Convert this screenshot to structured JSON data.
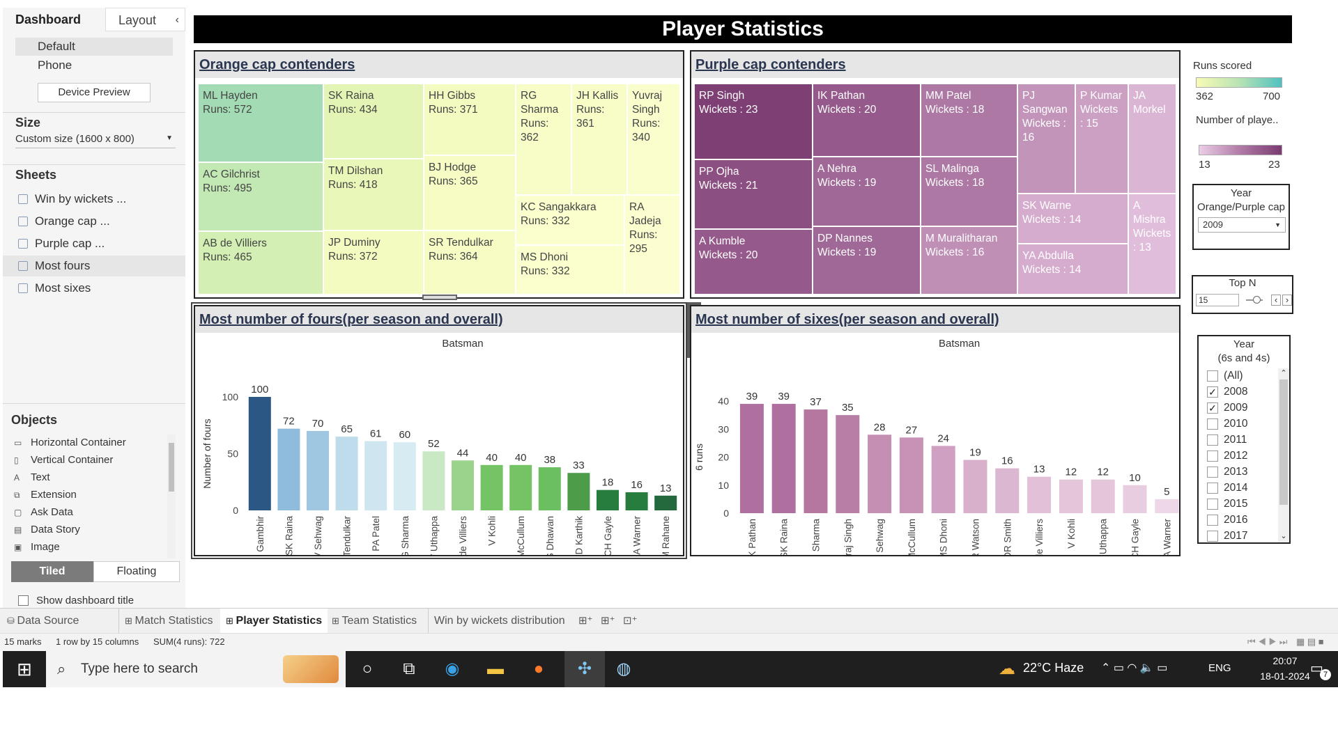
{
  "left_panel": {
    "tabs": {
      "dashboard": "Dashboard",
      "layout": "Layout"
    },
    "device": {
      "default": "Default",
      "phone": "Phone",
      "preview_button": "Device Preview"
    },
    "size": {
      "heading": "Size",
      "value": "Custom size (1600 x 800)"
    },
    "sheets": {
      "heading": "Sheets",
      "items": [
        "Win by wickets ...",
        "Orange cap ...",
        "Purple cap ...",
        "Most fours",
        "Most sixes"
      ]
    },
    "objects": {
      "heading": "Objects",
      "items": [
        "Horizontal Container",
        "Vertical Container",
        "Text",
        "Extension",
        "Ask Data",
        "Data Story",
        "Image"
      ]
    },
    "layout_mode": {
      "tiled": "Tiled",
      "floating": "Floating"
    },
    "show_title": "Show dashboard title"
  },
  "dashboard": {
    "title": "Player Statistics",
    "orange": {
      "heading": "Orange cap contenders",
      "cells": [
        {
          "name": "ML Hayden",
          "value": "Runs: 572",
          "color": "#a3dcb4"
        },
        {
          "name": "AC Gilchrist",
          "value": "Runs: 495",
          "color": "#c2e8b4"
        },
        {
          "name": "AB de Villiers",
          "value": "Runs: 465",
          "color": "#d3efb4"
        },
        {
          "name": "SK Raina",
          "value": "Runs: 434",
          "color": "#e2f5b4"
        },
        {
          "name": "TM Dilshan",
          "value": "Runs: 418",
          "color": "#e9f7b8"
        },
        {
          "name": "JP Duminy",
          "value": "Runs: 372",
          "color": "#f4fbc0"
        },
        {
          "name": "HH Gibbs",
          "value": "Runs: 371",
          "color": "#f4fbc0"
        },
        {
          "name": "BJ Hodge",
          "value": "Runs: 365",
          "color": "#f6fcc4"
        },
        {
          "name": "SR Tendulkar",
          "value": "Runs: 364",
          "color": "#f6fcc4"
        },
        {
          "name": "RG Sharma",
          "value": "Runs: 362",
          "color": "#f8fdc8"
        },
        {
          "name": "JH Kallis",
          "value": "Runs: 361",
          "color": "#f8fdc8"
        },
        {
          "name": "Yuvraj Singh",
          "value": "Runs: 340",
          "color": "#fafdcc"
        },
        {
          "name": "KC Sangakkara",
          "value": "Runs: 332",
          "color": "#fbfecd"
        },
        {
          "name": "MS Dhoni",
          "value": "Runs: 332",
          "color": "#fbfecd"
        },
        {
          "name": "RA Jadeja",
          "value": "Runs: 295",
          "color": "#fcfed0"
        }
      ]
    },
    "purple": {
      "heading": "Purple cap contenders",
      "cells": [
        {
          "name": "RP Singh",
          "value": "Wickets : 23",
          "color": "#7d3f74"
        },
        {
          "name": "PP Ojha",
          "value": "Wickets : 21",
          "color": "#8c4f82"
        },
        {
          "name": "A Kumble",
          "value": "Wickets : 20",
          "color": "#955a8b"
        },
        {
          "name": "IK Pathan",
          "value": "Wickets : 20",
          "color": "#955a8b"
        },
        {
          "name": "A Nehra",
          "value": "Wickets : 19",
          "color": "#a06896"
        },
        {
          "name": "DP Nannes",
          "value": "Wickets : 19",
          "color": "#a06896"
        },
        {
          "name": "MM Patel",
          "value": "Wickets : 18",
          "color": "#ad78a3"
        },
        {
          "name": "SL Malinga",
          "value": "Wickets : 18",
          "color": "#ad78a3"
        },
        {
          "name": "M Muralitharan",
          "value": "Wickets : 16",
          "color": "#bf8fb6"
        },
        {
          "name": "PJ Sangwan",
          "value": "Wickets : 16",
          "color": "#c294b9"
        },
        {
          "name": "P Kumar",
          "value": "Wickets : 15",
          "color": "#cba0c3"
        },
        {
          "name": "JA Morkel",
          "value": "",
          "color": "#dbb5d4"
        },
        {
          "name": "SK Warne",
          "value": "Wickets : 14",
          "color": "#d6acce"
        },
        {
          "name": "YA Abdulla",
          "value": "Wickets : 14",
          "color": "#d6acce"
        },
        {
          "name": "A Mishra",
          "value": "Wickets : 13",
          "color": "#e0bedb"
        }
      ]
    },
    "fours": {
      "heading": "Most number of fours(per season and overall)"
    },
    "sixes": {
      "heading": "Most number of sixes(per season and overall)"
    },
    "legend": {
      "runs_title": "Runs scored",
      "runs_min": "362",
      "runs_max": "700",
      "players_title": "Number of playe..",
      "players_min": "13",
      "players_max": "23"
    },
    "year_filter": {
      "title_line1": "Year",
      "title_line2": "Orange/Purple cap",
      "value": "2009"
    },
    "top_n": {
      "title": "Top N",
      "value": "15"
    },
    "year_list": {
      "title_line1": "Year",
      "title_line2": "(6s and 4s)",
      "items": [
        {
          "label": "(All)",
          "checked": false
        },
        {
          "label": "2008",
          "checked": true
        },
        {
          "label": "2009",
          "checked": true
        },
        {
          "label": "2010",
          "checked": false
        },
        {
          "label": "2011",
          "checked": false
        },
        {
          "label": "2012",
          "checked": false
        },
        {
          "label": "2013",
          "checked": false
        },
        {
          "label": "2014",
          "checked": false
        },
        {
          "label": "2015",
          "checked": false
        },
        {
          "label": "2016",
          "checked": false
        },
        {
          "label": "2017",
          "checked": false
        }
      ]
    }
  },
  "chart_data": [
    {
      "type": "bar",
      "title": "",
      "xlabel": "Batsman",
      "ylabel": "Number of fours",
      "ylim": [
        0,
        100
      ],
      "yticks": [
        0,
        50,
        100
      ],
      "categories": [
        "G Gambhir",
        "SK Raina",
        "V Sehwag",
        "SR Tendulkar",
        "PA Patel",
        "RG Sharma",
        "RV Uthappa",
        "AB de Villiers",
        "V Kohli",
        "BB McCullum",
        "S Dhawan",
        "KD Karthik",
        "CH Gayle",
        "DA Warner",
        "AM Rahane"
      ],
      "values": [
        100,
        72,
        70,
        65,
        61,
        60,
        52,
        44,
        40,
        40,
        38,
        33,
        18,
        16,
        13
      ],
      "colors": [
        "#2a5783",
        "#8fbcdc",
        "#9fc7e1",
        "#bfdcec",
        "#cfe6f0",
        "#d6ebf2",
        "#c9e9c5",
        "#99d38c",
        "#74c466",
        "#74c466",
        "#6bbf60",
        "#4c9c4a",
        "#277d3e",
        "#277d3e",
        "#24693d"
      ]
    },
    {
      "type": "bar",
      "title": "",
      "xlabel": "Batsman",
      "ylabel": "6 runs",
      "ylim": [
        0,
        40
      ],
      "yticks": [
        0,
        10,
        20,
        30,
        40
      ],
      "categories": [
        "YK Pathan",
        "SK Raina",
        "RG Sharma",
        "Yuvraj Singh",
        "V Sehwag",
        "BB McCullum",
        "MS Dhoni",
        "SR Watson",
        "DR Smith",
        "AB de Villiers",
        "V Kohli",
        "RV Uthappa",
        "CH Gayle",
        "DA Warner"
      ],
      "values": [
        39,
        39,
        37,
        35,
        28,
        27,
        24,
        19,
        16,
        13,
        12,
        12,
        10,
        5
      ],
      "colors": [
        "#b0709f",
        "#b0709f",
        "#b5779f",
        "#b97ea6",
        "#c58fb4",
        "#c892b7",
        "#cfa0c1",
        "#d8b0cc",
        "#dcb7d1",
        "#e2c1d8",
        "#e4c5da",
        "#e4c5da",
        "#e8cce0",
        "#eed8e7"
      ]
    }
  ],
  "sheet_tabs": {
    "data_source": "Data Source",
    "tabs": [
      "Match Statistics",
      "Player Statistics",
      "Team Statistics",
      "Win by wickets distribution"
    ]
  },
  "status": {
    "marks": "15 marks",
    "rows": "1 row by 15 columns",
    "sum": "SUM(4 runs): 722"
  },
  "taskbar": {
    "search": "Type here to search",
    "weather": "22°C  Haze",
    "lang": "ENG",
    "time": "20:07",
    "date": "18-01-2024",
    "notif": "7"
  }
}
